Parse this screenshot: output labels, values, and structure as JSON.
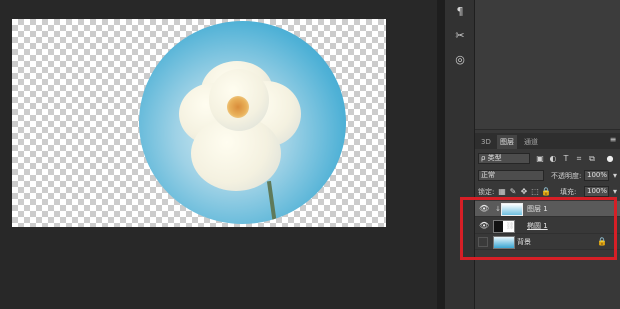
{
  "tool_strip": {
    "items": [
      {
        "name": "paragraph-icon",
        "glyph": "¶"
      },
      {
        "name": "tools-icon",
        "glyph": "✂"
      },
      {
        "name": "3d-object-icon",
        "glyph": "◎"
      }
    ]
  },
  "tabs": [
    "3D",
    "图层",
    "通道"
  ],
  "filter": {
    "kind_label": "ρ 类型"
  },
  "blend": {
    "mode": "正常",
    "opacity_label": "不透明度:",
    "opacity_value": "100%"
  },
  "lock": {
    "label": "锁定:",
    "fill_label": "填充:",
    "fill_value": "100%"
  },
  "layers": [
    {
      "name": "图层 1",
      "visible": true,
      "selected": true
    },
    {
      "name": "椭圆 1",
      "visible": true,
      "selected": false
    },
    {
      "name": "背景",
      "visible": false,
      "selected": false,
      "locked": true
    }
  ],
  "colors": {
    "highlight": "#d61f26",
    "sky_blue": "#4fb1d6"
  }
}
